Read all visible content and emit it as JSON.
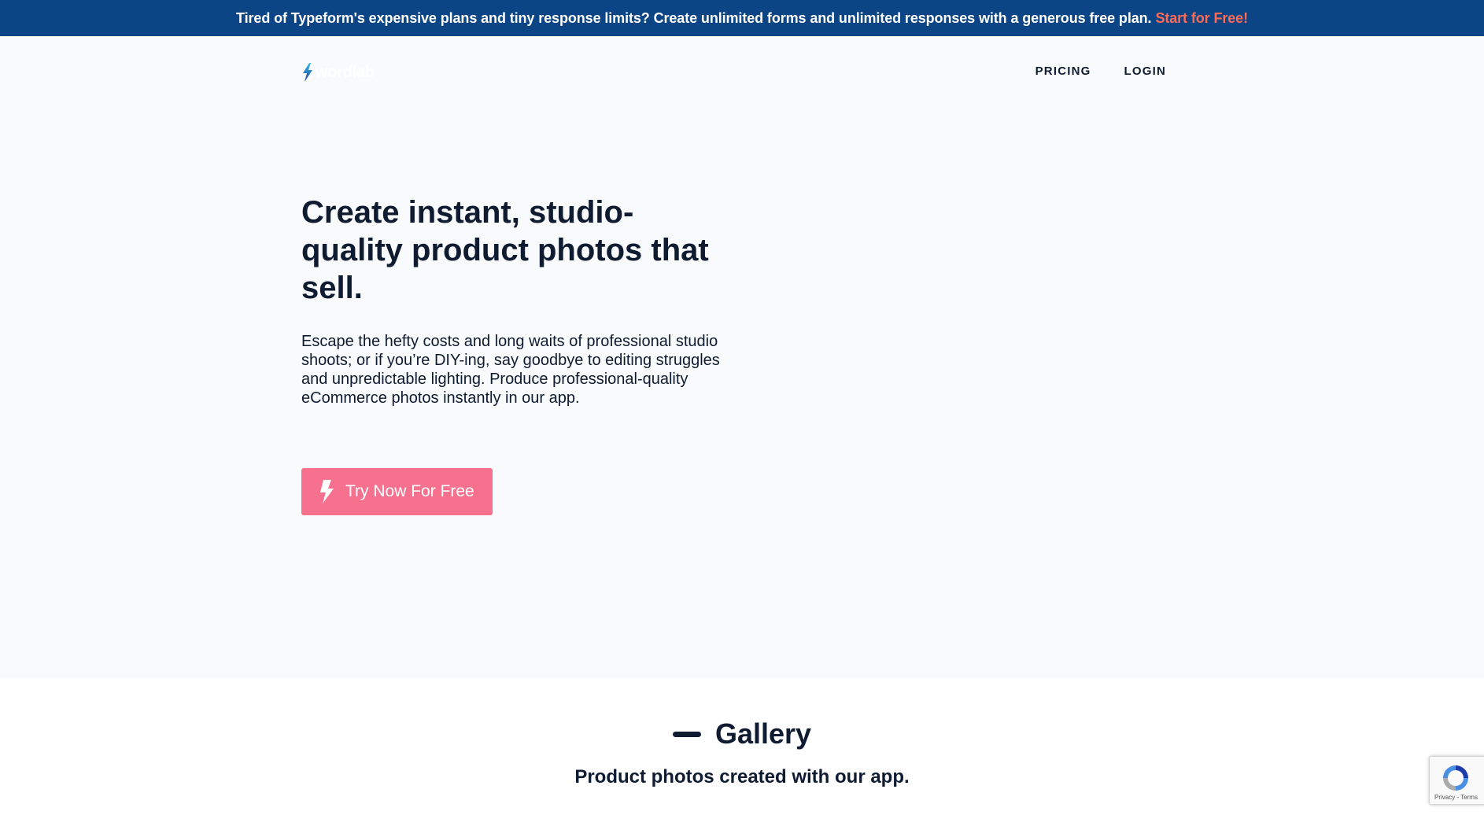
{
  "banner": {
    "text": "Tired of Typeform's expensive plans and tiny response limits? Create unlimited forms and unlimited responses with a generous free plan.",
    "link_label": "Start for Free!",
    "background_color": "#0b4585",
    "link_color": "#ff6a55"
  },
  "nav": {
    "logo_text": "wordlab",
    "logo_icon": "lightning-bolt-icon",
    "links": [
      {
        "label": "PRICING"
      },
      {
        "label": "LOGIN"
      }
    ]
  },
  "hero": {
    "title": "Create instant, studio-quality product photos that sell.",
    "subtitle": "Escape the hefty costs and long waits of professional studio shoots; or if you’re DIY-ing, say goodbye to editing struggles and unpredictable lighting. Produce professional-quality eCommerce photos instantly in our app.",
    "cta_label": "Try Now For Free",
    "cta_icon": "lightning-bolt-icon",
    "cta_color": "#f7708e"
  },
  "gallery": {
    "title": "Gallery",
    "subtitle": "Product photos created with our app."
  },
  "recaptcha": {
    "terms_text": "Privacy - Terms",
    "icon": "recaptcha-icon"
  }
}
